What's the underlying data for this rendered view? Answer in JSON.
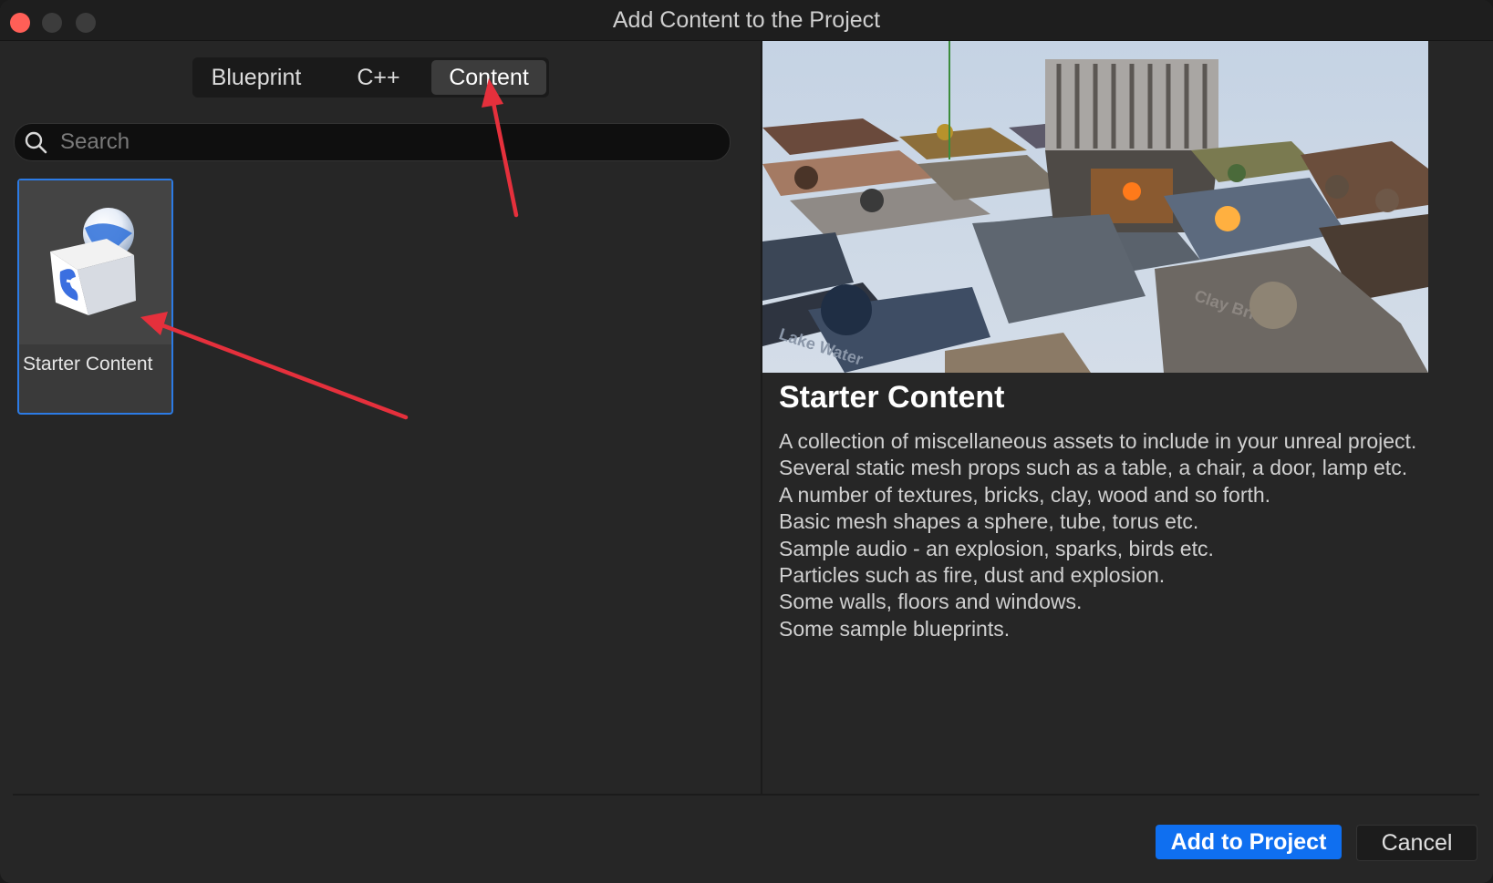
{
  "window": {
    "title": "Add Content to the Project"
  },
  "tabs": [
    {
      "label": "Blueprint",
      "active": false
    },
    {
      "label": "C++",
      "active": false
    },
    {
      "label": "Content",
      "active": true
    }
  ],
  "search": {
    "placeholder": "Search",
    "value": ""
  },
  "tiles": [
    {
      "label": "Starter Content",
      "selected": true,
      "icon": "unreal-starter-content-icon"
    }
  ],
  "detail": {
    "title": "Starter Content",
    "description": [
      "A collection of miscellaneous assets to include in your unreal project.",
      "Several static mesh props such as a table, a chair, a door, lamp etc.",
      "A number of textures, bricks, clay, wood and so forth.",
      "Basic mesh shapes a sphere, tube, torus etc.",
      "Sample audio - an explosion, sparks, birds etc.",
      "Particles such as fire, dust and explosion.",
      "Some walls, floors and windows.",
      "Some sample blueprints."
    ],
    "preview_labels": {
      "lake_water": "Lake Water",
      "clay_brick": "Clay Brick"
    }
  },
  "buttons": {
    "add": "Add to Project",
    "cancel": "Cancel"
  },
  "colors": {
    "accent": "#0f6ff0",
    "annotation_arrow": "#e5303c",
    "selection_border": "#2c7be5"
  }
}
